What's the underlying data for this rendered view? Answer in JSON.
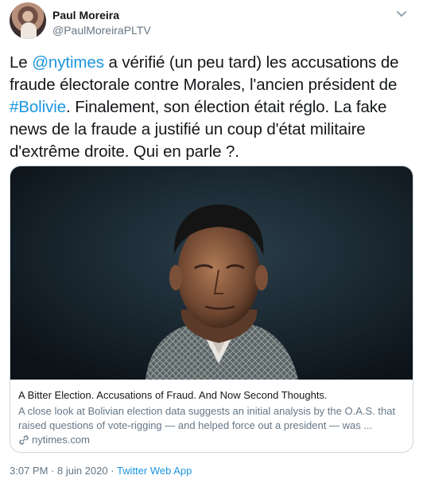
{
  "tweet": {
    "author": {
      "name": "Paul Moreira",
      "handle": "@PaulMoreiraPLTV"
    },
    "text": {
      "p1": "Le ",
      "mention": "@nytimes",
      "p2": " a vérifié (un peu tard) les accusations de fraude électorale contre Morales, l'ancien président de ",
      "hashtag": "#Bolivie",
      "p3": ". Finalement, son élection était réglo. La fake news de la fraude a justifié un coup d'état militaire d'extrême droite. Qui en parle ?."
    },
    "card": {
      "title": "A Bitter Election. Accusations of Fraud. And Now Second Thoughts.",
      "description": "A close look at Bolivian election data suggests an initial analysis by the O.A.S. that raised questions of vote-rigging — and helped force out a president — was ...",
      "domain": "nytimes.com",
      "icon": "link-icon",
      "image": "photo of a man in a patterned jacket against a dark background"
    },
    "footer": {
      "time": "3:07 PM",
      "separator1": " · ",
      "date": "8 juin 2020",
      "separator2": " · ",
      "app": "Twitter Web App"
    },
    "colors": {
      "link": "#1b95e0",
      "secondary": "#657786",
      "primary": "#14171a",
      "border": "#ccd6dd"
    }
  }
}
